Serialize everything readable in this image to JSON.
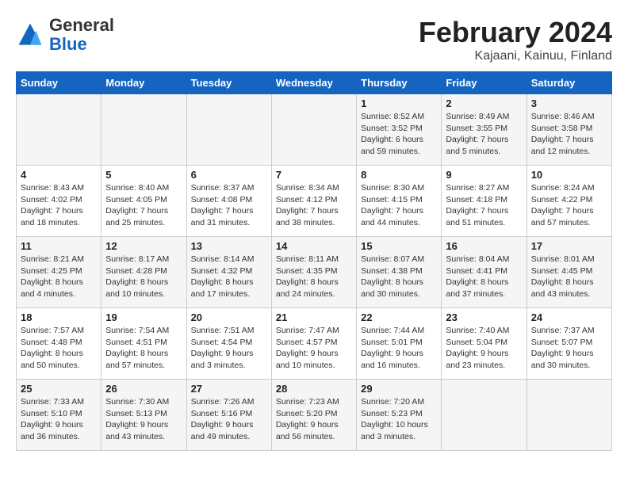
{
  "header": {
    "logo_line1": "General",
    "logo_line2": "Blue",
    "title": "February 2024",
    "subtitle": "Kajaani, Kainuu, Finland"
  },
  "weekdays": [
    "Sunday",
    "Monday",
    "Tuesday",
    "Wednesday",
    "Thursday",
    "Friday",
    "Saturday"
  ],
  "weeks": [
    [
      {
        "day": "",
        "info": ""
      },
      {
        "day": "",
        "info": ""
      },
      {
        "day": "",
        "info": ""
      },
      {
        "day": "",
        "info": ""
      },
      {
        "day": "1",
        "info": "Sunrise: 8:52 AM\nSunset: 3:52 PM\nDaylight: 6 hours\nand 59 minutes."
      },
      {
        "day": "2",
        "info": "Sunrise: 8:49 AM\nSunset: 3:55 PM\nDaylight: 7 hours\nand 5 minutes."
      },
      {
        "day": "3",
        "info": "Sunrise: 8:46 AM\nSunset: 3:58 PM\nDaylight: 7 hours\nand 12 minutes."
      }
    ],
    [
      {
        "day": "4",
        "info": "Sunrise: 8:43 AM\nSunset: 4:02 PM\nDaylight: 7 hours\nand 18 minutes."
      },
      {
        "day": "5",
        "info": "Sunrise: 8:40 AM\nSunset: 4:05 PM\nDaylight: 7 hours\nand 25 minutes."
      },
      {
        "day": "6",
        "info": "Sunrise: 8:37 AM\nSunset: 4:08 PM\nDaylight: 7 hours\nand 31 minutes."
      },
      {
        "day": "7",
        "info": "Sunrise: 8:34 AM\nSunset: 4:12 PM\nDaylight: 7 hours\nand 38 minutes."
      },
      {
        "day": "8",
        "info": "Sunrise: 8:30 AM\nSunset: 4:15 PM\nDaylight: 7 hours\nand 44 minutes."
      },
      {
        "day": "9",
        "info": "Sunrise: 8:27 AM\nSunset: 4:18 PM\nDaylight: 7 hours\nand 51 minutes."
      },
      {
        "day": "10",
        "info": "Sunrise: 8:24 AM\nSunset: 4:22 PM\nDaylight: 7 hours\nand 57 minutes."
      }
    ],
    [
      {
        "day": "11",
        "info": "Sunrise: 8:21 AM\nSunset: 4:25 PM\nDaylight: 8 hours\nand 4 minutes."
      },
      {
        "day": "12",
        "info": "Sunrise: 8:17 AM\nSunset: 4:28 PM\nDaylight: 8 hours\nand 10 minutes."
      },
      {
        "day": "13",
        "info": "Sunrise: 8:14 AM\nSunset: 4:32 PM\nDaylight: 8 hours\nand 17 minutes."
      },
      {
        "day": "14",
        "info": "Sunrise: 8:11 AM\nSunset: 4:35 PM\nDaylight: 8 hours\nand 24 minutes."
      },
      {
        "day": "15",
        "info": "Sunrise: 8:07 AM\nSunset: 4:38 PM\nDaylight: 8 hours\nand 30 minutes."
      },
      {
        "day": "16",
        "info": "Sunrise: 8:04 AM\nSunset: 4:41 PM\nDaylight: 8 hours\nand 37 minutes."
      },
      {
        "day": "17",
        "info": "Sunrise: 8:01 AM\nSunset: 4:45 PM\nDaylight: 8 hours\nand 43 minutes."
      }
    ],
    [
      {
        "day": "18",
        "info": "Sunrise: 7:57 AM\nSunset: 4:48 PM\nDaylight: 8 hours\nand 50 minutes."
      },
      {
        "day": "19",
        "info": "Sunrise: 7:54 AM\nSunset: 4:51 PM\nDaylight: 8 hours\nand 57 minutes."
      },
      {
        "day": "20",
        "info": "Sunrise: 7:51 AM\nSunset: 4:54 PM\nDaylight: 9 hours\nand 3 minutes."
      },
      {
        "day": "21",
        "info": "Sunrise: 7:47 AM\nSunset: 4:57 PM\nDaylight: 9 hours\nand 10 minutes."
      },
      {
        "day": "22",
        "info": "Sunrise: 7:44 AM\nSunset: 5:01 PM\nDaylight: 9 hours\nand 16 minutes."
      },
      {
        "day": "23",
        "info": "Sunrise: 7:40 AM\nSunset: 5:04 PM\nDaylight: 9 hours\nand 23 minutes."
      },
      {
        "day": "24",
        "info": "Sunrise: 7:37 AM\nSunset: 5:07 PM\nDaylight: 9 hours\nand 30 minutes."
      }
    ],
    [
      {
        "day": "25",
        "info": "Sunrise: 7:33 AM\nSunset: 5:10 PM\nDaylight: 9 hours\nand 36 minutes."
      },
      {
        "day": "26",
        "info": "Sunrise: 7:30 AM\nSunset: 5:13 PM\nDaylight: 9 hours\nand 43 minutes."
      },
      {
        "day": "27",
        "info": "Sunrise: 7:26 AM\nSunset: 5:16 PM\nDaylight: 9 hours\nand 49 minutes."
      },
      {
        "day": "28",
        "info": "Sunrise: 7:23 AM\nSunset: 5:20 PM\nDaylight: 9 hours\nand 56 minutes."
      },
      {
        "day": "29",
        "info": "Sunrise: 7:20 AM\nSunset: 5:23 PM\nDaylight: 10 hours\nand 3 minutes."
      },
      {
        "day": "",
        "info": ""
      },
      {
        "day": "",
        "info": ""
      }
    ]
  ]
}
